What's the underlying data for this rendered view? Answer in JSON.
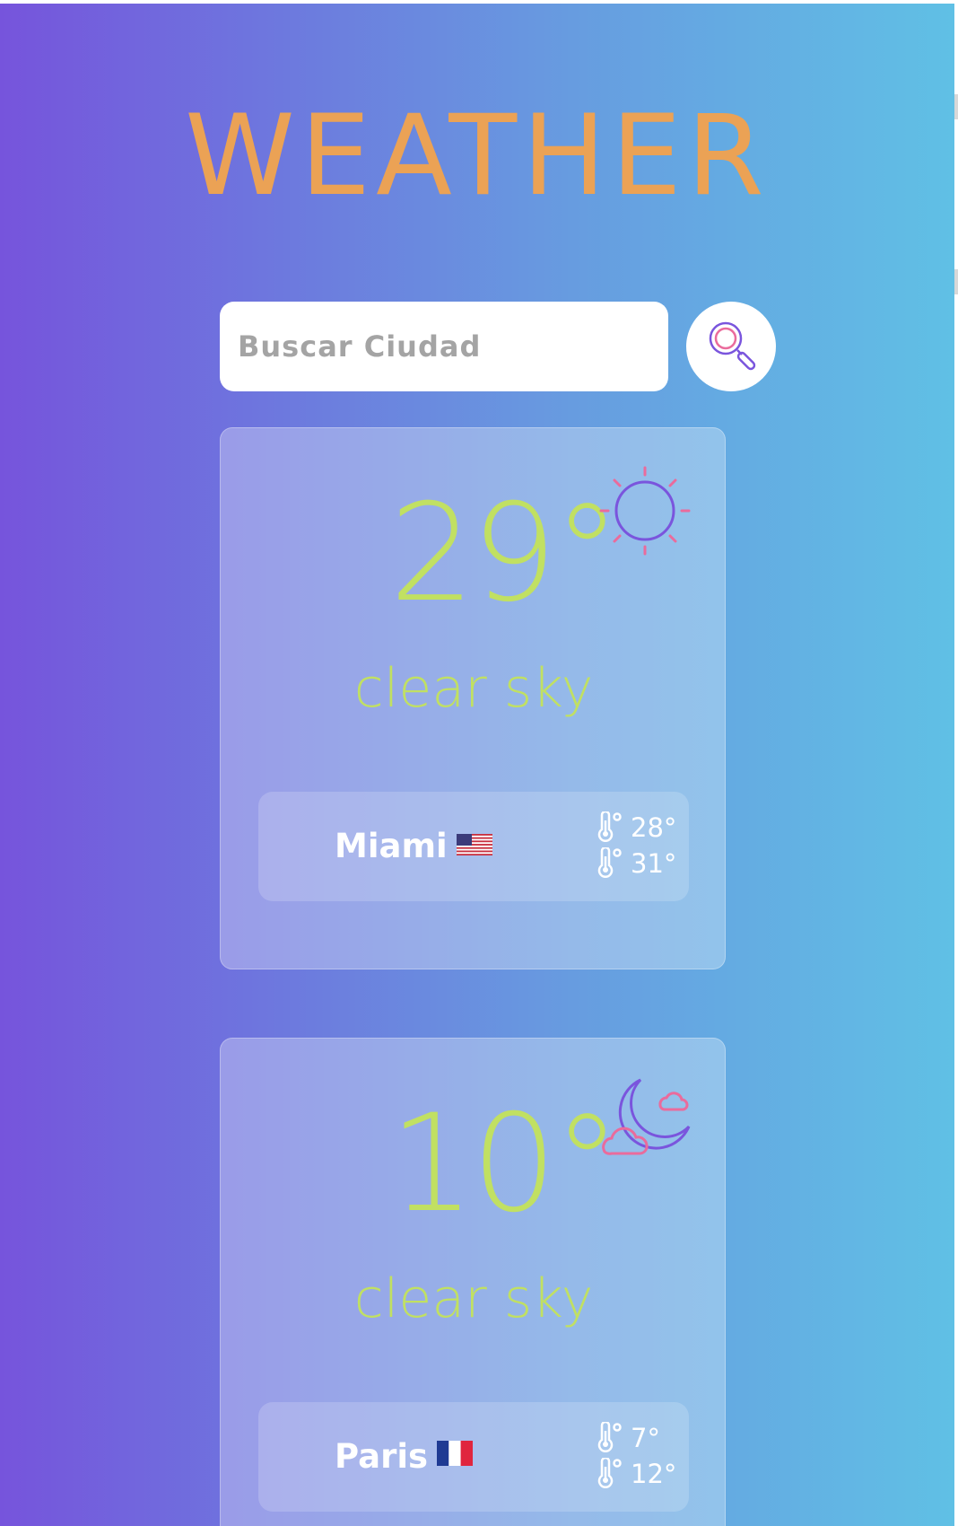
{
  "app": {
    "title": "WEATHER"
  },
  "search": {
    "placeholder": "Buscar Ciudad",
    "button_icon": "search-icon"
  },
  "colors": {
    "title": "#eba255",
    "temperature": "#c1e062",
    "gradient_start": "#7654dc",
    "gradient_end": "#60c0e5",
    "icon_purple": "#7a55dd",
    "icon_pink": "#ea6b9c"
  },
  "cards": [
    {
      "temperature": "29°",
      "description": "clear sky",
      "icon": "sun-icon",
      "city": "Miami",
      "flag": "us-flag-icon",
      "min_temp": "28°",
      "max_temp": "31°"
    },
    {
      "temperature": "10°",
      "description": "clear sky",
      "icon": "moon-clouds-icon",
      "city": "Paris",
      "flag": "fr-flag-icon",
      "min_temp": "7°",
      "max_temp": "12°"
    }
  ]
}
